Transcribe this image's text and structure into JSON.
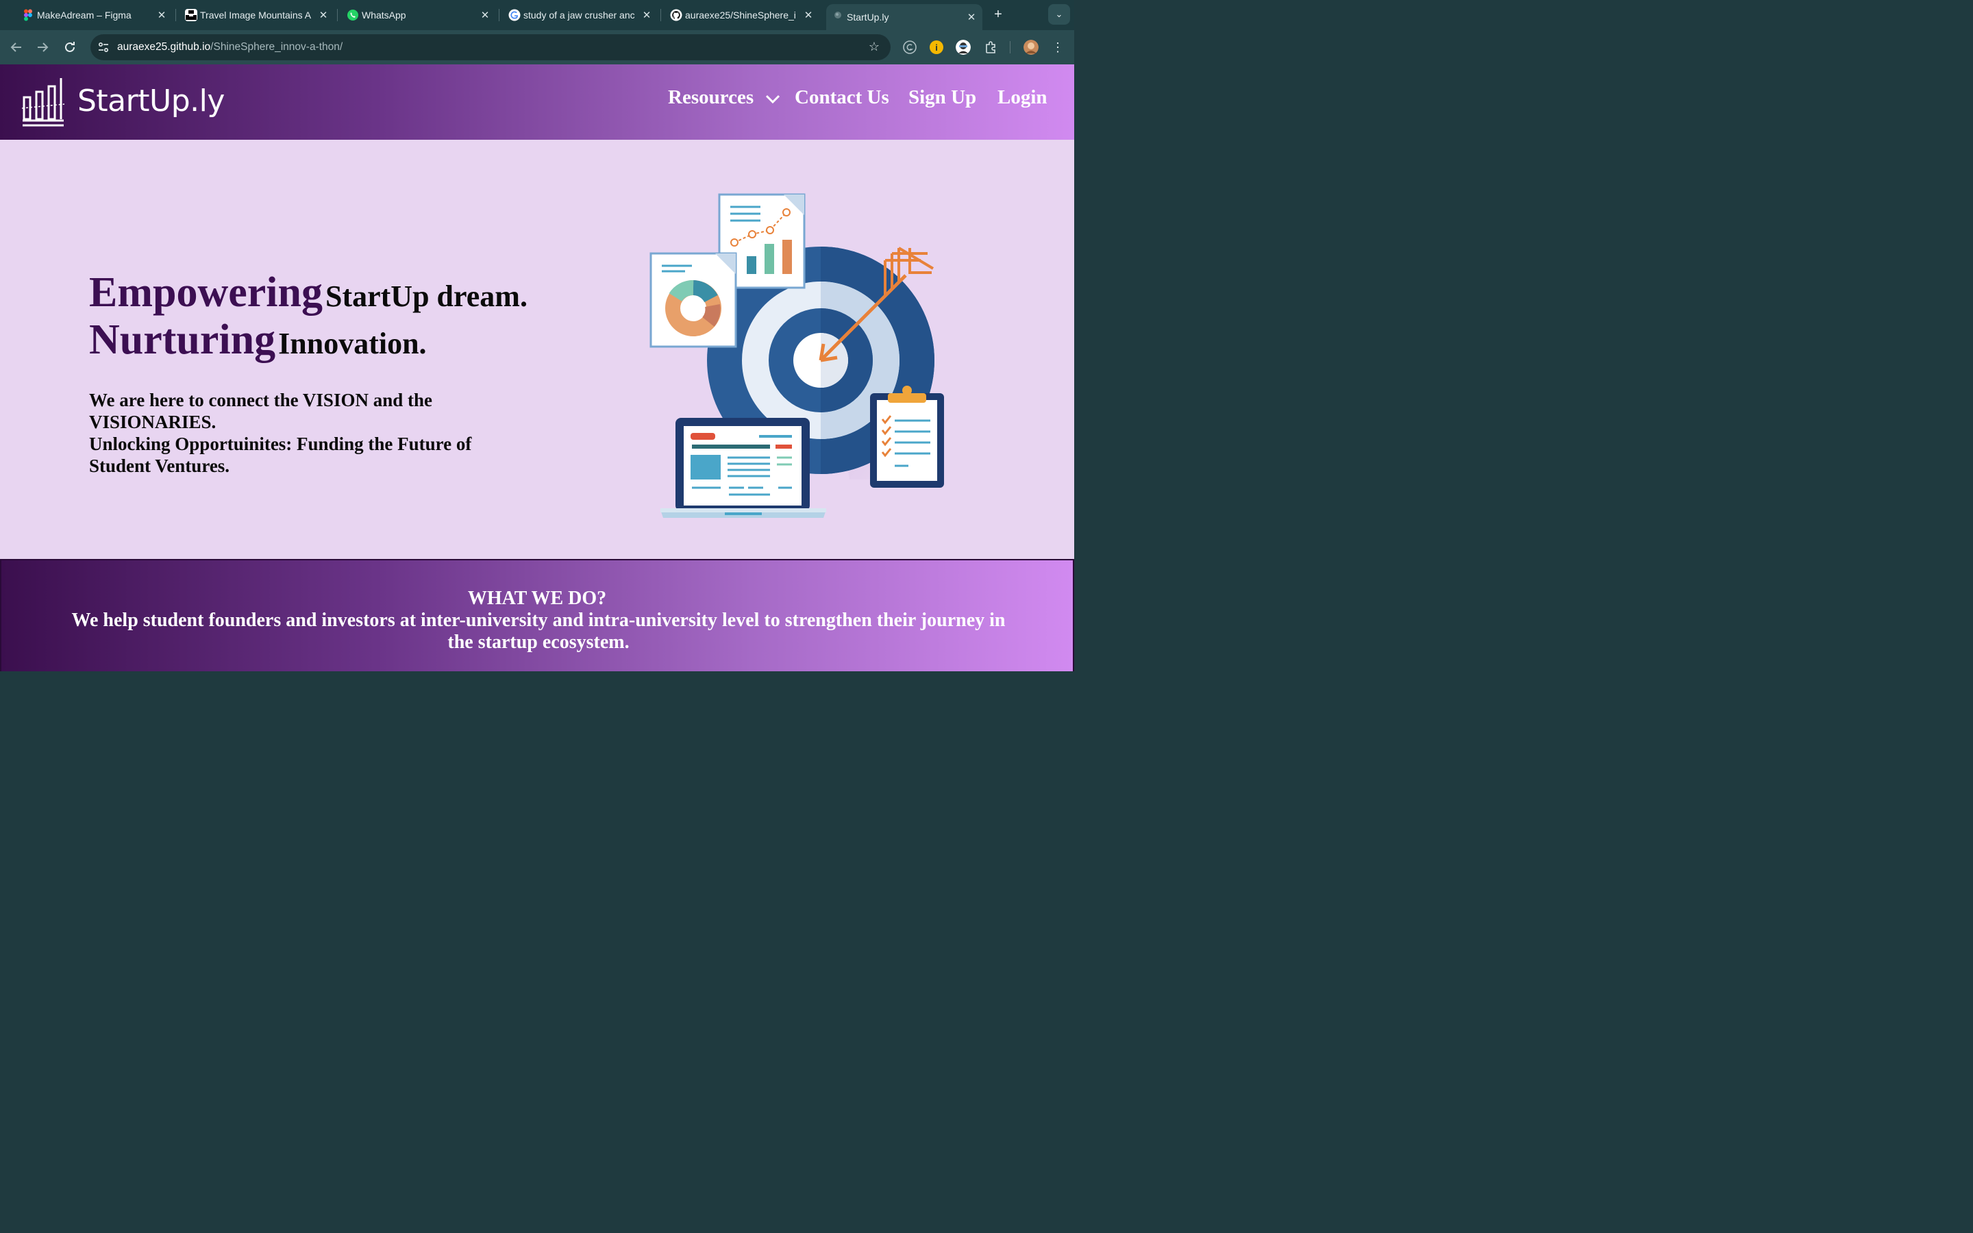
{
  "browser": {
    "tabs": [
      {
        "title": "MakeAdream – Figma",
        "favicon": "figma-icon"
      },
      {
        "title": "Travel Image Mountains A",
        "favicon": "unsplash-icon"
      },
      {
        "title": "WhatsApp",
        "favicon": "whatsapp-icon"
      },
      {
        "title": "study of a jaw crusher anc",
        "favicon": "google-icon"
      },
      {
        "title": "auraexe25/ShineSphere_i",
        "favicon": "github-icon"
      },
      {
        "title": "StartUp.ly",
        "favicon": "globe-icon",
        "active": true
      }
    ],
    "url_host": "auraexe25.github.io",
    "url_path": "/ShineSphere_innov-a-thon/"
  },
  "site": {
    "brand": "StartUp.ly",
    "nav": {
      "resources": "Resources",
      "contact": "Contact Us",
      "signup": "Sign Up",
      "login": "Login"
    },
    "hero": {
      "line1_big": "Empowering",
      "line1_small": "StartUp dream.",
      "line2_big": "Nurturing",
      "line2_small": "Innovation.",
      "para_line1": "We are here to connect the VISION and the VISIONARIES.",
      "para_line2": "Unlocking Opportuinites: Funding the Future of Student Ventures."
    },
    "what_we_do": {
      "title": "WHAT WE DO?",
      "description": "We help student founders and investors at inter-university and intra-university level to strengthen their journey in the startup ecosystem."
    }
  },
  "colors": {
    "header_gradient_start": "#3b0f4e",
    "header_gradient_end": "#d18af0",
    "hero_background": "#e8d5f1",
    "headline_purple": "#3c0f52",
    "target_blue": "#2b5d97",
    "arrow_orange": "#e8823a"
  }
}
